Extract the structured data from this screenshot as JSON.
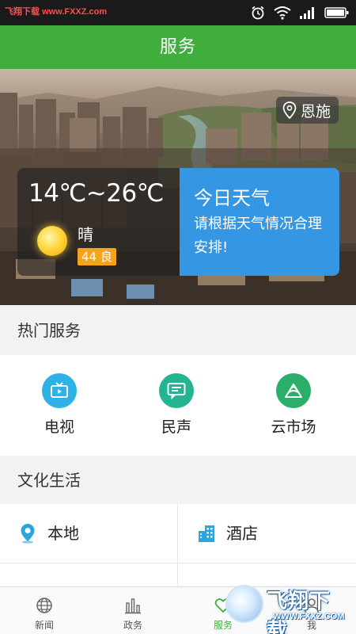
{
  "status_bar": {
    "watermark_label": "飞翔下载",
    "watermark_domain": "www.FXXZ.com",
    "icons": [
      "alarm-icon",
      "wifi-icon",
      "signal-icon",
      "battery-icon"
    ]
  },
  "header": {
    "title": "服务"
  },
  "banner": {
    "location": "恩施",
    "weather": {
      "temperature": "14℃~26℃",
      "condition": "晴",
      "aqi": "44 良"
    },
    "today": {
      "title": "今日天气",
      "description": "请根据天气情况合理安排!"
    }
  },
  "hot_services": {
    "title": "热门服务",
    "items": [
      {
        "label": "电视",
        "icon": "tv-icon",
        "color": "#2db1e6"
      },
      {
        "label": "民声",
        "icon": "chat-icon",
        "color": "#23b494"
      },
      {
        "label": "云市场",
        "icon": "cloud-market-icon",
        "color": "#2aae6a"
      }
    ]
  },
  "culture": {
    "title": "文化生活",
    "items": [
      {
        "label": "本地",
        "icon": "location-pin-icon",
        "color": "#2aa5e0"
      },
      {
        "label": "酒店",
        "icon": "hotel-building-icon",
        "color": "#2aa5e0"
      }
    ]
  },
  "bottom_nav": {
    "items": [
      {
        "label": "新闻",
        "icon": "globe-icon"
      },
      {
        "label": "政务",
        "icon": "bar-chart-icon"
      },
      {
        "label": "服务",
        "icon": "heart-icon",
        "active": true
      },
      {
        "label": "我",
        "icon": "person-icon"
      }
    ],
    "active_color": "#3fae3c"
  },
  "watermark": {
    "brand": "飞翔下载",
    "url": "WWW.FXXZ.COM"
  }
}
